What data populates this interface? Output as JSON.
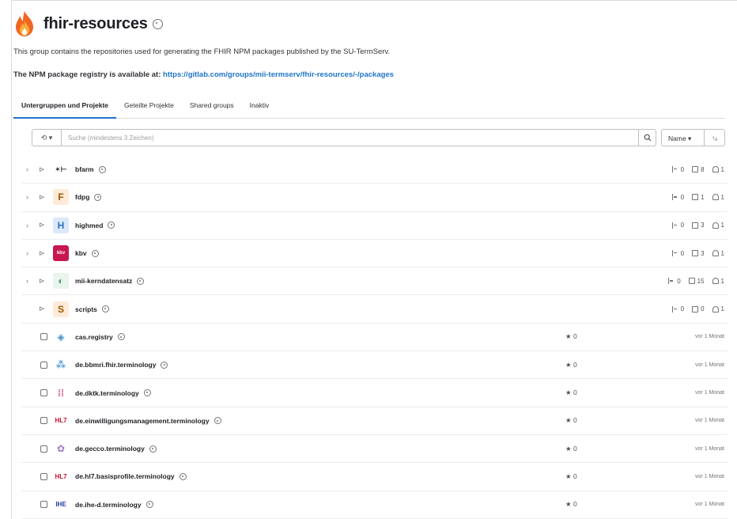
{
  "group": {
    "title": "fhir-resources",
    "description": "This group contains the repositories used for generating the FHIR NPM packages published by the SU-TermServ.",
    "registry_prefix": "The NPM package registry is available at: ",
    "registry_link": "https://gitlab.com/groups/mii-termserv/fhir-resources/-/packages"
  },
  "tabs": [
    {
      "label": "Untergruppen und Projekte",
      "active": true
    },
    {
      "label": "Geteilte Projekte",
      "active": false
    },
    {
      "label": "Shared groups",
      "active": false
    },
    {
      "label": "Inaktiv",
      "active": false
    }
  ],
  "filter": {
    "history_glyph": "⟲ ▾",
    "search_placeholder": "Suche (mindestens 3 Zeichen)",
    "sort_label": "Name ▾",
    "sort_dir": "↑ₐ"
  },
  "groups": [
    {
      "name": "bfarm",
      "avatar": "✶⊢",
      "avatar_bg": "#ffffff",
      "avatar_color": "#1f1e24",
      "subgroups": "0",
      "projects": "8",
      "members": "1"
    },
    {
      "name": "fdpg",
      "avatar": "F",
      "avatar_bg": "#fdebd8",
      "avatar_color": "#9e5400",
      "subgroups": "0",
      "projects": "1",
      "members": "1"
    },
    {
      "name": "highmed",
      "avatar": "H",
      "avatar_bg": "#dbe8fb",
      "avatar_color": "#2f6fbf",
      "subgroups": "0",
      "projects": "3",
      "members": "1"
    },
    {
      "name": "kbv",
      "avatar": "kbv",
      "avatar_bg": "#c8174f",
      "avatar_color": "#ffffff",
      "subgroups": "0",
      "projects": "3",
      "members": "1"
    },
    {
      "name": "mii-kerndatensatz",
      "avatar": "◐",
      "avatar_bg": "#e8f4ec",
      "avatar_color": "#4a9a6b",
      "subgroups": "0",
      "projects": "15",
      "members": "1"
    },
    {
      "name": "scripts",
      "avatar": "S",
      "avatar_bg": "#fdebd8",
      "avatar_color": "#9e5400",
      "subgroups": "0",
      "projects": "0",
      "members": "1"
    }
  ],
  "projects": [
    {
      "name": "cas.registry",
      "avatar": "◈",
      "avatar_color": "#3f8ec7",
      "stars": "0",
      "updated": "vor 1 Monat"
    },
    {
      "name": "de.bbmri.fhir.terminology",
      "avatar": "⁂",
      "avatar_color": "#5a9bd6",
      "stars": "0",
      "updated": "vor 1 Monat"
    },
    {
      "name": "de.dktk.terminology",
      "avatar": "⁞⁞",
      "avatar_color": "#d64a8a",
      "stars": "0",
      "updated": "vor 1 Monat"
    },
    {
      "name": "de.einwilligungsmanagement.terminology",
      "avatar": "HL7",
      "avatar_color": "#c8102e",
      "stars": "0",
      "updated": "vor 1 Monat"
    },
    {
      "name": "de.gecco.terminology",
      "avatar": "✿",
      "avatar_color": "#9b7bc7",
      "stars": "0",
      "updated": "vor 1 Monat"
    },
    {
      "name": "de.hl7.basisprofile.terminology",
      "avatar": "HL7",
      "avatar_color": "#c8102e",
      "stars": "0",
      "updated": "vor 1 Monat"
    },
    {
      "name": "de.ihe-d.terminology",
      "avatar": "IHE",
      "avatar_color": "#1d3d8f",
      "stars": "0",
      "updated": "vor 1 Monat"
    }
  ]
}
